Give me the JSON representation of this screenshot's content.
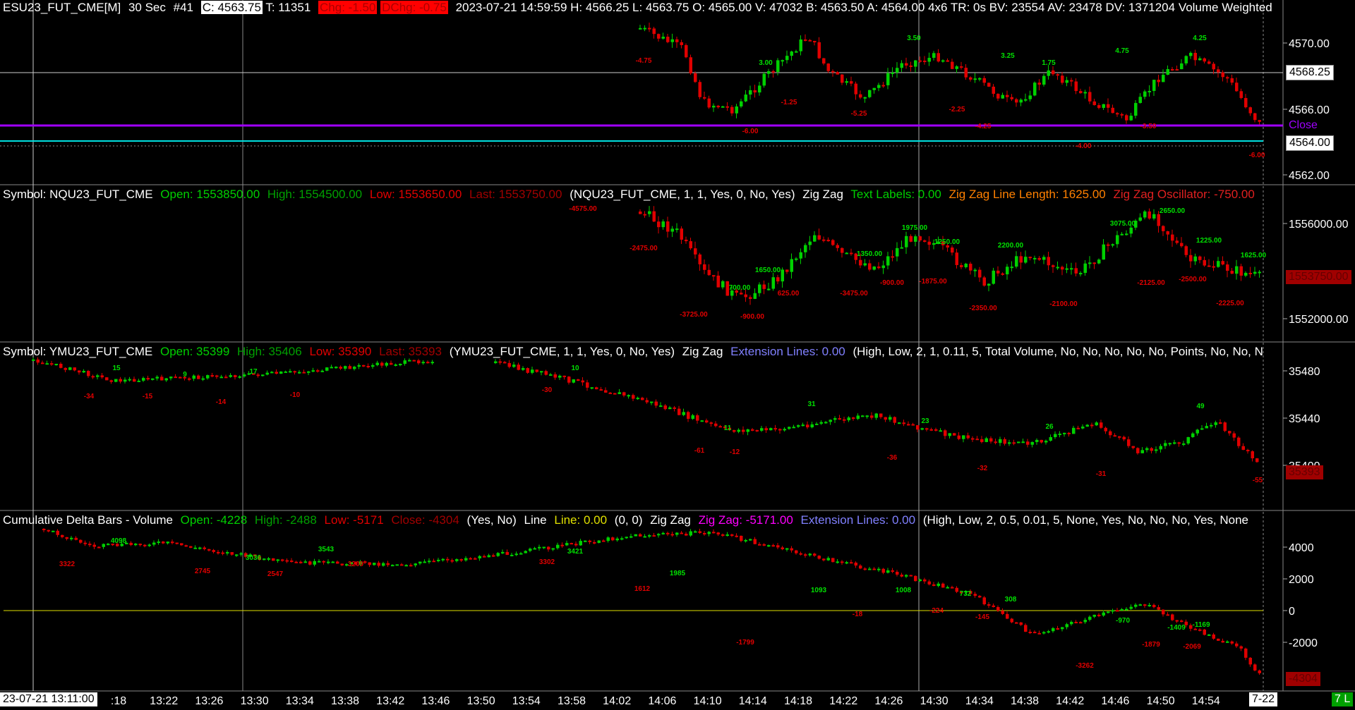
{
  "main": {
    "symbol": "ESU23_FUT_CME[M]",
    "interval": "30 Sec",
    "chart_num": "#41",
    "close": "C: 4563.75",
    "trades": "T: 11351",
    "chg": "Chg: -1.50",
    "dchg": "DChg: -0.75",
    "info": "2023-07-21 14:59:59 H: 4566.25 L: 4563.75 O: 4565.00 V: 47032 B: 4563.50 A: 4564.00 4x6 TR: 0s BV: 23554 AV: 23478 DV: 1371204 Volume Weighted",
    "ticks": [
      "4570.00",
      "4566.00",
      "4562.00"
    ],
    "price_box": "4568.25",
    "close_label": "Close",
    "cur_price": "4564.00",
    "zz_up": [
      "3.00",
      "3.50",
      "3.25",
      "1.75",
      "4.75",
      "4.25"
    ],
    "zz_dn": [
      "-4.75",
      "-1.25",
      "-6.00",
      "-5.25",
      "-2.25",
      "-4.25",
      "-4.00",
      "-3.50",
      "-6.00"
    ]
  },
  "nq": {
    "symbol": "Symbol: NQU23_FUT_CME",
    "open": "Open: 1553850.00",
    "high": "High: 1554500.00",
    "low": "Low: 1553650.00",
    "last": "Last: 1553750.00",
    "params": "(NQU23_FUT_CME, 1, 1, Yes, 0, No, Yes)",
    "zz": "Zig Zag",
    "text_labels": "Text Labels: 0.00",
    "line_length": "Zig Zag Line Length: 1625.00",
    "osc": "Zig Zag Oscillator: -750.00",
    "ticks": [
      "1556000.00",
      "1552000.00"
    ],
    "last_box": "1553750.00",
    "zz_up": [
      "1650.00",
      "700.00",
      "1350.00",
      "1975.00",
      "1250.00",
      "2200.00",
      "3075.00",
      "2650.00",
      "1225.00",
      "1625.00"
    ],
    "zz_dn": [
      "-4575.00",
      "-2475.00",
      "-3725.00",
      "-900.00",
      "625.00",
      "-3475.00",
      "-900.00",
      "-1875.00",
      "-2350.00",
      "-2100.00",
      "-2125.00",
      "-2500.00",
      "-2225.00"
    ]
  },
  "ym": {
    "symbol": "Symbol: YMU23_FUT_CME",
    "open": "Open: 35399",
    "high": "High: 35406",
    "low": "Low: 35390",
    "last": "Last: 35393",
    "params": "(YMU23_FUT_CME, 1, 1, Yes, 0, No, Yes)",
    "zz": "Zig Zag",
    "ext": "Extension Lines: 0.00",
    "args": "(High, Low, 2, 1, 0.11, 5, Total Volume, No, No, No, No, No, Points, No, No, N",
    "ticks": [
      "35480",
      "35440",
      "35400"
    ],
    "last_box": "35393",
    "zz_up": [
      "15",
      "9",
      "17",
      "10",
      "11",
      "31",
      "23",
      "26",
      "49"
    ],
    "zz_dn": [
      "-34",
      "-15",
      "-14",
      "-10",
      "-30",
      "-61",
      "-12",
      "-36",
      "-32",
      "-31",
      "-55"
    ]
  },
  "cd": {
    "title": "Cumulative Delta Bars - Volume",
    "open": "Open: -4228",
    "high": "High: -2488",
    "low": "Low: -5171",
    "close": "Close: -4304",
    "yn": "(Yes, No)",
    "line_word": "Line",
    "line": "Line: 0.00",
    "zero": "(0, 0)",
    "zz": "Zig Zag",
    "zzval": "Zig Zag: -5171.00",
    "ext": "Extension Lines: 0.00",
    "args": "(High, Low, 2, 0.5, 0.01, 5, None, Yes, No, No, No, Yes, None",
    "ticks": [
      "4000",
      "2000",
      "0",
      "-2000"
    ],
    "last_box": "-4304",
    "zz_up": [
      "4098",
      "3036",
      "3543",
      "3421",
      "1985",
      "1093",
      "1008",
      "732",
      "308",
      "-970",
      "-1409",
      "-1169"
    ],
    "zz_dn": [
      "3322",
      "2745",
      "2547",
      "3209",
      "3302",
      "1612",
      "-1799",
      "-18",
      "-224",
      "-145",
      "-3262",
      "-1879",
      "-2069"
    ]
  },
  "xaxis": {
    "cursor_label": "23-07-21  13:11:00",
    "times": [
      ":18",
      "13:22",
      "13:26",
      "13:30",
      "13:34",
      "13:38",
      "13:42",
      "13:46",
      "13:50",
      "13:54",
      "13:58",
      "14:02",
      "14:06",
      "14:10",
      "14:14",
      "14:18",
      "14:22",
      "14:26",
      "14:30",
      "14:34",
      "14:38",
      "14:42",
      "14:46",
      "14:50",
      "14:54"
    ],
    "end_label": "7-22",
    "status": "7 L"
  },
  "colors": {
    "up": "#00d000",
    "down": "#e00000",
    "purple": "#a000ff",
    "cyan": "#00e0e0",
    "zero": "#e0e000",
    "green_text": "#00e000",
    "red_text": "#e00000"
  }
}
